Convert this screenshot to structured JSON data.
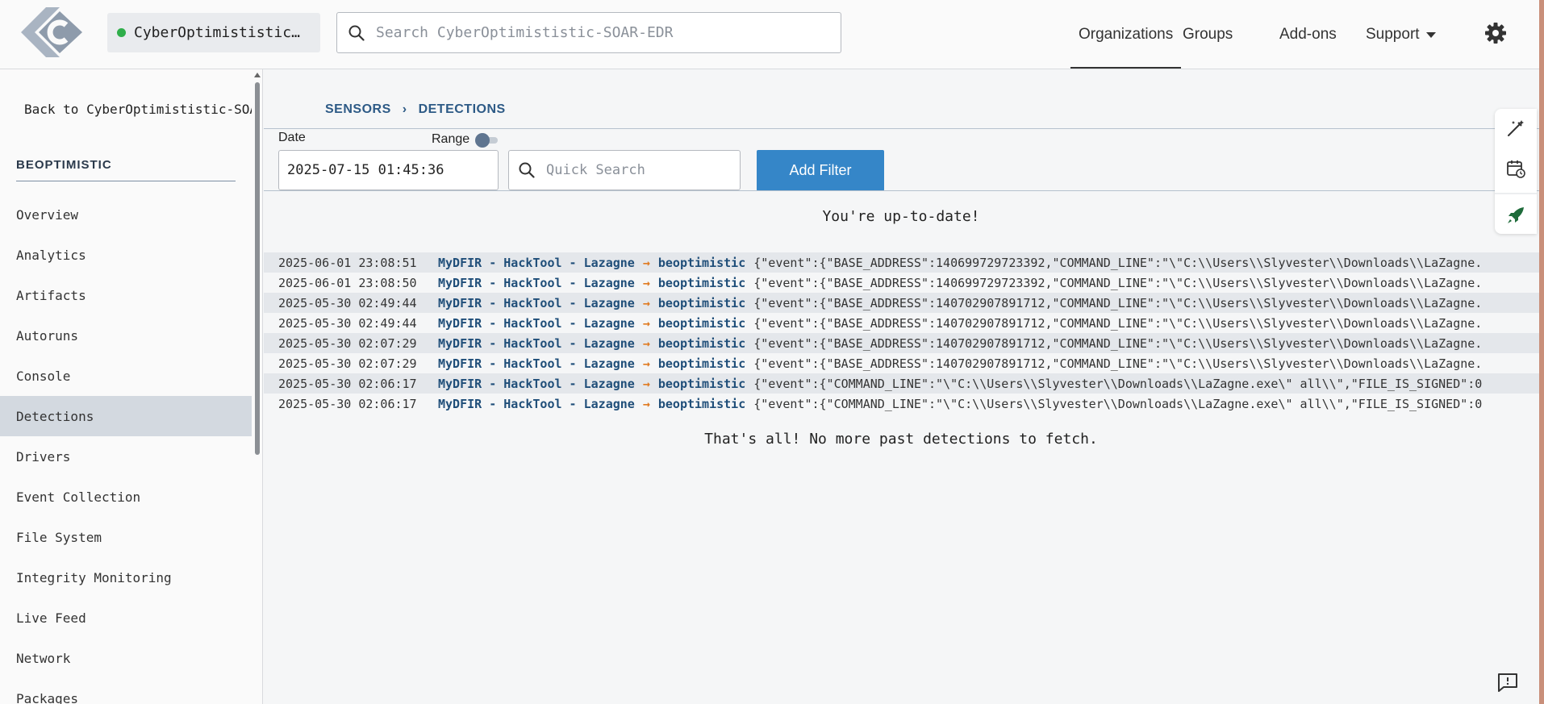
{
  "header": {
    "org_name": "CyberOptimististic…",
    "search_placeholder": "Search CyberOptimististic-SOAR-EDR",
    "nav": {
      "organizations": "Organizations",
      "groups": "Groups",
      "addons": "Add-ons",
      "support": "Support"
    },
    "status_color": "#2fae4a"
  },
  "sidebar": {
    "back_label": "Back to CyberOptimististic-SOAR-EDR",
    "section_title": "BEOPTIMISTIC",
    "items": [
      {
        "label": "Overview"
      },
      {
        "label": "Analytics"
      },
      {
        "label": "Artifacts"
      },
      {
        "label": "Autoruns"
      },
      {
        "label": "Console"
      },
      {
        "label": "Detections"
      },
      {
        "label": "Drivers"
      },
      {
        "label": "Event Collection"
      },
      {
        "label": "File System"
      },
      {
        "label": "Integrity Monitoring"
      },
      {
        "label": "Live Feed"
      },
      {
        "label": "Network"
      },
      {
        "label": "Packages"
      }
    ],
    "active_item": "Detections"
  },
  "main": {
    "breadcrumb": {
      "root": "SENSORS",
      "separator": "›",
      "current": "DETECTIONS"
    },
    "date_label": "Date",
    "range_label": "Range",
    "date_value": "2025-07-15 01:45:36",
    "quick_search_placeholder": "Quick Search",
    "add_filter_label": "Add Filter",
    "uptodate_message": "You're up-to-date!",
    "end_message": "That's all! No more past detections to fetch.",
    "arrow": "→",
    "detections": [
      {
        "ts": "2025-06-01 23:08:51",
        "rule": "MyDFIR - HackTool - Lazagne",
        "host": "beoptimistic",
        "event": "{\"event\":{\"BASE_ADDRESS\":140699729723392,\"COMMAND_LINE\":\"\\\"C:\\\\Users\\\\Slyvester\\\\Downloads\\\\LaZagne."
      },
      {
        "ts": "2025-06-01 23:08:50",
        "rule": "MyDFIR - HackTool - Lazagne",
        "host": "beoptimistic",
        "event": "{\"event\":{\"BASE_ADDRESS\":140699729723392,\"COMMAND_LINE\":\"\\\"C:\\\\Users\\\\Slyvester\\\\Downloads\\\\LaZagne."
      },
      {
        "ts": "2025-05-30 02:49:44",
        "rule": "MyDFIR - HackTool - Lazagne",
        "host": "beoptimistic",
        "event": "{\"event\":{\"BASE_ADDRESS\":140702907891712,\"COMMAND_LINE\":\"\\\"C:\\\\Users\\\\Slyvester\\\\Downloads\\\\LaZagne."
      },
      {
        "ts": "2025-05-30 02:49:44",
        "rule": "MyDFIR - HackTool - Lazagne",
        "host": "beoptimistic",
        "event": "{\"event\":{\"BASE_ADDRESS\":140702907891712,\"COMMAND_LINE\":\"\\\"C:\\\\Users\\\\Slyvester\\\\Downloads\\\\LaZagne."
      },
      {
        "ts": "2025-05-30 02:07:29",
        "rule": "MyDFIR - HackTool - Lazagne",
        "host": "beoptimistic",
        "event": "{\"event\":{\"BASE_ADDRESS\":140702907891712,\"COMMAND_LINE\":\"\\\"C:\\\\Users\\\\Slyvester\\\\Downloads\\\\LaZagne."
      },
      {
        "ts": "2025-05-30 02:07:29",
        "rule": "MyDFIR - HackTool - Lazagne",
        "host": "beoptimistic",
        "event": "{\"event\":{\"BASE_ADDRESS\":140702907891712,\"COMMAND_LINE\":\"\\\"C:\\\\Users\\\\Slyvester\\\\Downloads\\\\LaZagne."
      },
      {
        "ts": "2025-05-30 02:06:17",
        "rule": "MyDFIR - HackTool - Lazagne",
        "host": "beoptimistic",
        "event": "{\"event\":{\"COMMAND_LINE\":\"\\\"C:\\\\Users\\\\Slyvester\\\\Downloads\\\\LaZagne.exe\\\" all\\\\\",\"FILE_IS_SIGNED\":0"
      },
      {
        "ts": "2025-05-30 02:06:17",
        "rule": "MyDFIR - HackTool - Lazagne",
        "host": "beoptimistic",
        "event": "{\"event\":{\"COMMAND_LINE\":\"\\\"C:\\\\Users\\\\Slyvester\\\\Downloads\\\\LaZagne.exe\\\" all\\\\\",\"FILE_IS_SIGNED\":0"
      }
    ]
  },
  "icons": {
    "logo": "limacharlie-logo",
    "search": "search-icon",
    "settings": "gear-icon",
    "wand": "magic-wand-icon",
    "calendar": "calendar-icon",
    "rocket": "rocket-icon",
    "feedback": "feedback-icon"
  }
}
